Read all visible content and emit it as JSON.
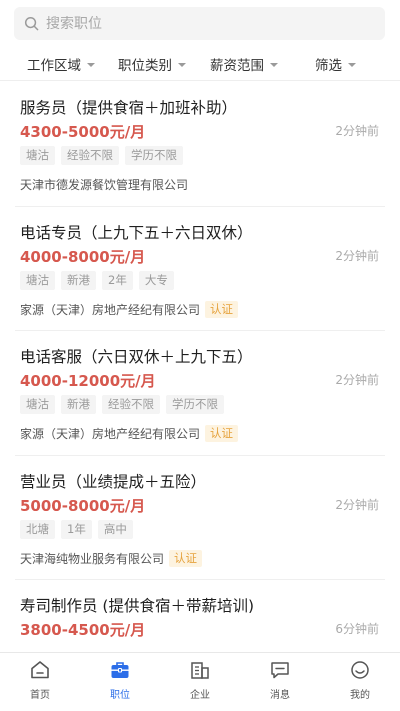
{
  "search": {
    "placeholder": "搜索职位"
  },
  "filters": [
    {
      "label": "工作区域"
    },
    {
      "label": "职位类别"
    },
    {
      "label": "薪资范围"
    },
    {
      "label": "筛选"
    }
  ],
  "jobs": [
    {
      "title": "服务员（提供食宿＋加班补助）",
      "salary": "4300-5000元/月",
      "time": "2分钟前",
      "tags": [
        "塘沽",
        "经验不限",
        "学历不限"
      ],
      "company": "天津市德发源餐饮管理有限公司",
      "cert": ""
    },
    {
      "title": "电话专员（上九下五＋六日双休）",
      "salary": "4000-8000元/月",
      "time": "2分钟前",
      "tags": [
        "塘沽",
        "新港",
        "2年",
        "大专"
      ],
      "company": "家源（天津）房地产经纪有限公司",
      "cert": "认证"
    },
    {
      "title": "电话客服（六日双休＋上九下五）",
      "salary": "4000-12000元/月",
      "time": "2分钟前",
      "tags": [
        "塘沽",
        "新港",
        "经验不限",
        "学历不限"
      ],
      "company": "家源（天津）房地产经纪有限公司",
      "cert": "认证"
    },
    {
      "title": "营业员（业绩提成＋五险）",
      "salary": "5000-8000元/月",
      "time": "2分钟前",
      "tags": [
        "北塘",
        "1年",
        "高中"
      ],
      "company": "天津海纯物业服务有限公司",
      "cert": "认证"
    },
    {
      "title": "寿司制作员 (提供食宿＋带薪培训)",
      "salary": "3800-4500元/月",
      "time": "6分钟前",
      "tags": [],
      "company": "",
      "cert": ""
    }
  ],
  "tabbar": [
    {
      "label": "首页",
      "icon": "home-icon",
      "active": false
    },
    {
      "label": "职位",
      "icon": "briefcase-icon",
      "active": true
    },
    {
      "label": "企业",
      "icon": "building-icon",
      "active": false
    },
    {
      "label": "消息",
      "icon": "message-icon",
      "active": false
    },
    {
      "label": "我的",
      "icon": "profile-icon",
      "active": false
    }
  ],
  "colors": {
    "accent": "#2b6de8",
    "salary": "#d6584e",
    "cert_text": "#e6a33e",
    "cert_bg": "#fdf3e0"
  }
}
